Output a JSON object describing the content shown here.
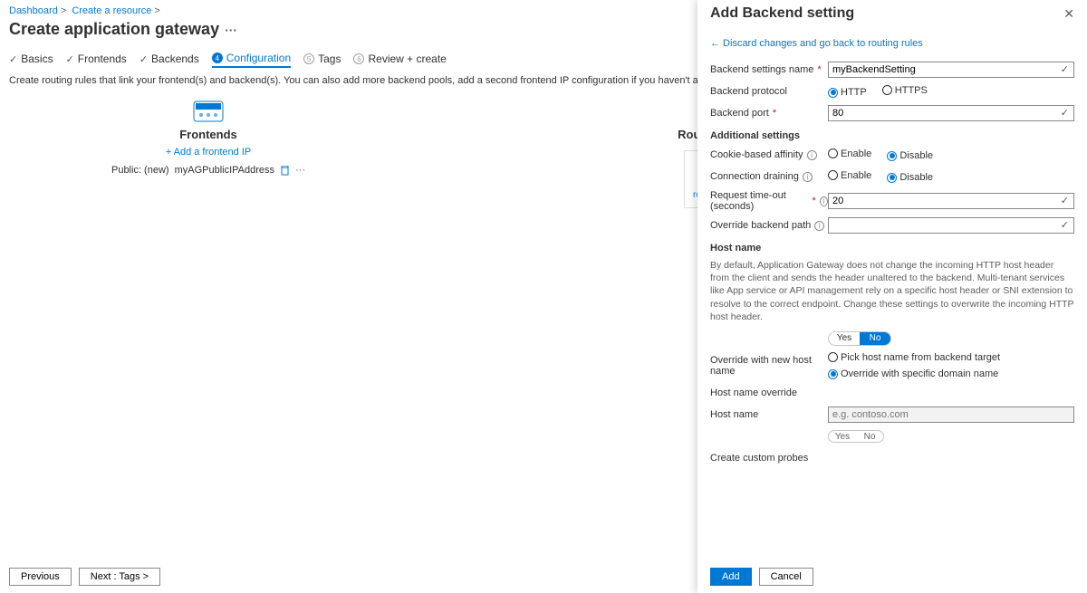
{
  "breadcrumb": [
    "Dashboard",
    "Create a resource"
  ],
  "page_title": "Create application gateway",
  "tabs": {
    "basics": "Basics",
    "frontends": "Frontends",
    "backends": "Backends",
    "configuration": "Configuration",
    "tags": {
      "num": "5",
      "label": "Tags"
    },
    "review": {
      "num": "6",
      "label": "Review + create"
    }
  },
  "desc": "Create routing rules that link your frontend(s) and backend(s). You can also add more backend pools, add a second frontend IP configuration if you haven't already, or edit previous configurations.",
  "frontends": {
    "title": "Frontends",
    "add_link": "+ Add a frontend IP",
    "item_prefix": "Public: (new) ",
    "item_value": "myAGPublicIPAddress"
  },
  "rules": {
    "title": "Routing rules",
    "card_label": "Add a routing rule"
  },
  "footer": {
    "prev": "Previous",
    "next": "Next : Tags >"
  },
  "panel": {
    "title": "Add Backend setting",
    "back": "← Discard changes and go back to routing rules",
    "labels": {
      "name": "Backend settings name",
      "protocol": "Backend protocol",
      "port": "Backend port",
      "additional": "Additional settings",
      "affinity": "Cookie-based affinity",
      "draining": "Connection draining",
      "timeout": "Request time-out (seconds)",
      "override_path": "Override backend path",
      "hostname": "Host name",
      "override_hostname": "Override with new host name",
      "host_override_h": "Host name override",
      "hostname_l": "Host name",
      "probes": "Create custom probes"
    },
    "values": {
      "name": "myBackendSetting",
      "port": "80",
      "timeout": "20",
      "override_path": "",
      "hostname_placeholder": "e.g. contoso.com"
    },
    "radios": {
      "http": "HTTP",
      "https": "HTTPS",
      "enable": "Enable",
      "disable": "Disable",
      "pick": "Pick host name from backend target",
      "specific": "Override with specific domain name"
    },
    "toggle": {
      "yes": "Yes",
      "no": "No"
    },
    "help_host": "By default, Application Gateway does not change the incoming HTTP host header from the client and sends the header unaltered to the backend. Multi-tenant services like App service or API management rely on a specific host header or SNI extension to resolve to the correct endpoint. Change these settings to overwrite the incoming HTTP host header.",
    "buttons": {
      "add": "Add",
      "cancel": "Cancel"
    }
  }
}
